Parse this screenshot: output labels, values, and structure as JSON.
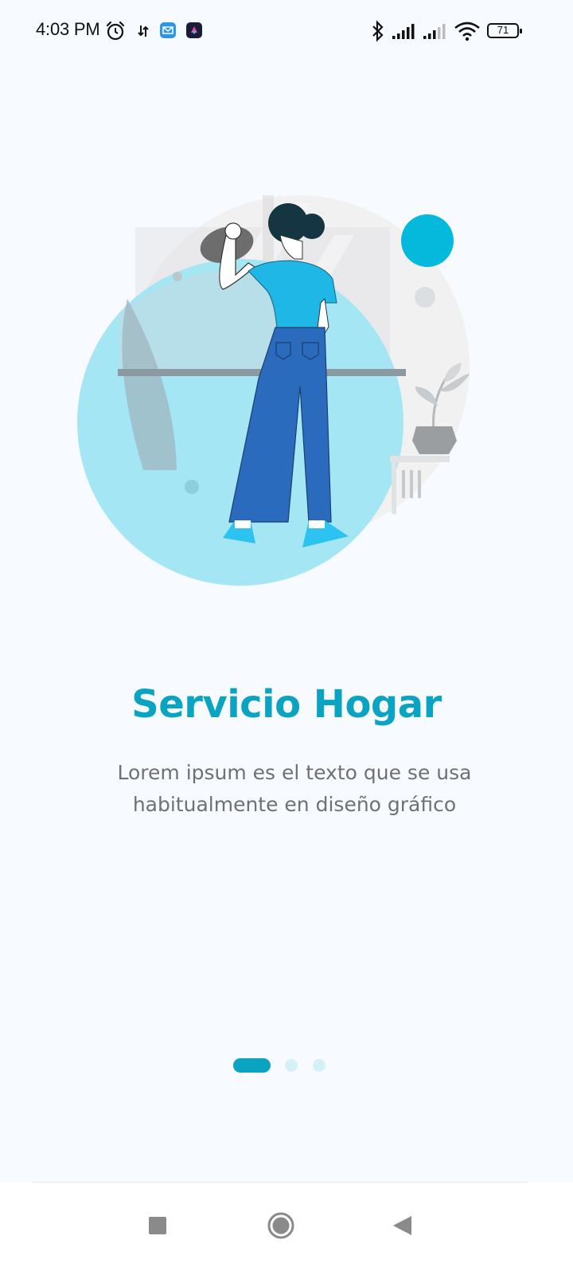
{
  "status_bar": {
    "time": "4:03 PM",
    "battery_level": "71",
    "icons": [
      "alarm-icon",
      "network-activity-icon",
      "mail-app-icon",
      "app-notification-icon",
      "bluetooth-icon",
      "signal-icon",
      "signal-icon",
      "wifi-icon",
      "battery-icon"
    ]
  },
  "onboarding": {
    "title": "Servicio Hogar",
    "description": "Lorem ipsum es el texto que se usa habitualmente en diseño gráfico",
    "current_page": 1,
    "total_pages": 3
  },
  "nav_bar": {
    "buttons": [
      "recents-button",
      "home-button",
      "back-button"
    ]
  },
  "colors": {
    "accent": "#0aa3c2",
    "dot_inactive": "#d4f1f8",
    "circle_light": "#a5e6f5",
    "shirt": "#1fb8e6",
    "pants": "#2b6bbd",
    "background": "#f7fbff"
  }
}
